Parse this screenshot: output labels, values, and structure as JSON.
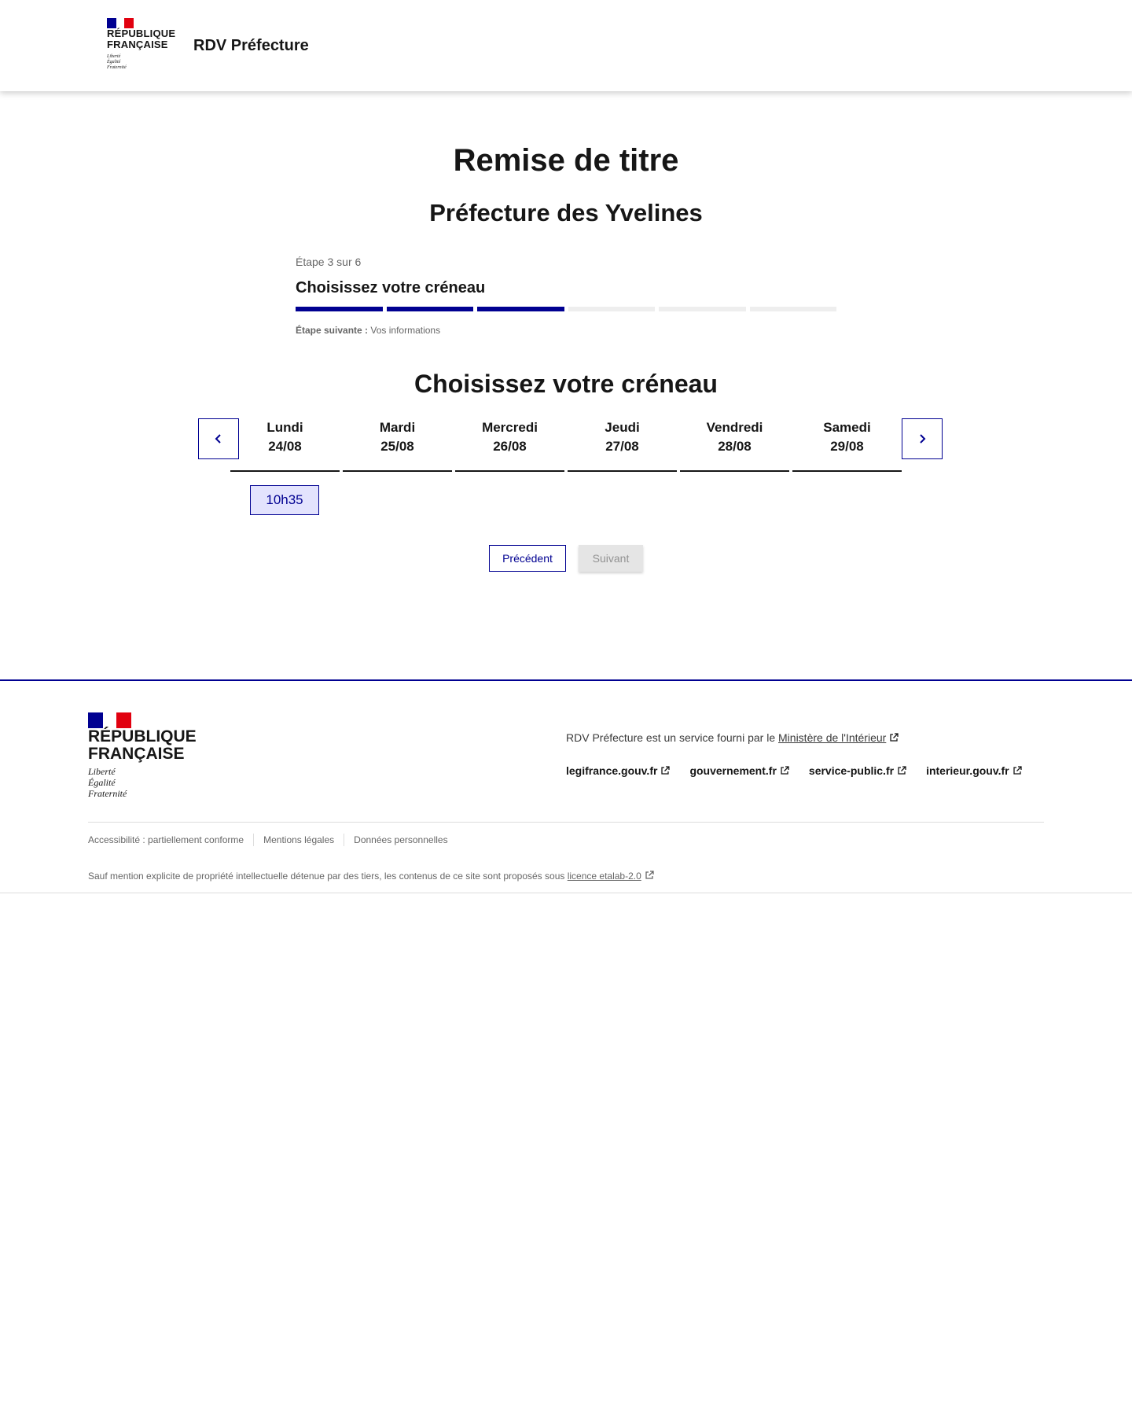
{
  "header": {
    "logo_lines": [
      "RÉPUBLIQUE",
      "FRANÇAISE"
    ],
    "motto": [
      "Liberté",
      "Égalité",
      "Fraternité"
    ],
    "service_title": "RDV Préfecture"
  },
  "main": {
    "title": "Remise de titre",
    "subtitle": "Préfecture des Yvelines",
    "stepper": {
      "state": "Étape 3 sur 6",
      "current_step": "Choisissez votre créneau",
      "current": 3,
      "total": 6,
      "next_label": "Étape suivante :",
      "next_value": "Vos informations"
    },
    "section_title": "Choisissez votre créneau",
    "days": [
      {
        "name": "Lundi",
        "date": "24/08"
      },
      {
        "name": "Mardi",
        "date": "25/08"
      },
      {
        "name": "Mercredi",
        "date": "26/08"
      },
      {
        "name": "Jeudi",
        "date": "27/08"
      },
      {
        "name": "Vendredi",
        "date": "28/08"
      },
      {
        "name": "Samedi",
        "date": "29/08"
      }
    ],
    "slots": [
      {
        "day_index": 0,
        "time": "10h35"
      }
    ],
    "buttons": {
      "previous": "Précédent",
      "next": "Suivant"
    }
  },
  "footer": {
    "logo_lines": [
      "RÉPUBLIQUE",
      "FRANÇAISE"
    ],
    "motto": [
      "Liberté",
      "Égalité",
      "Fraternité"
    ],
    "description_prefix": "RDV Préfecture est un service fourni par le",
    "description_link": "Ministère de l'Intérieur",
    "links": [
      "legifrance.gouv.fr",
      "gouvernement.fr",
      "service-public.fr",
      "interieur.gouv.fr"
    ],
    "bottom_links": [
      "Accessibilité : partiellement conforme",
      "Mentions légales",
      "Données personnelles"
    ],
    "license_prefix": "Sauf mention explicite de propriété intellectuelle détenue par des tiers, les contenus de ce site sont proposés sous",
    "license_link": "licence etalab-2.0"
  },
  "colors": {
    "brand_blue": "#000091",
    "marianne_red": "#e1000f",
    "slot_bg": "#e3e3fd",
    "disabled_bg": "#e5e5e5"
  }
}
